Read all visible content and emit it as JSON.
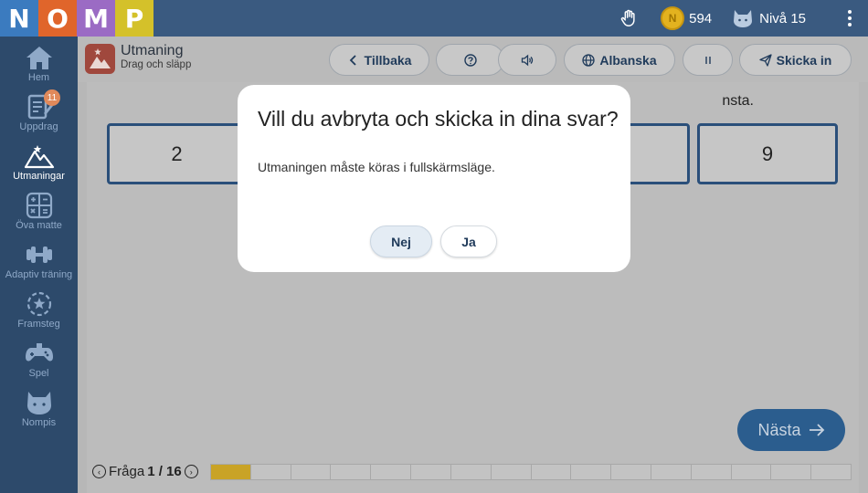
{
  "logo": {
    "letters": [
      "N",
      "O",
      "M",
      "P"
    ],
    "colors": [
      "#3b7bbf",
      "#e0652b",
      "#9b6bc4",
      "#d4c12a"
    ]
  },
  "topbar": {
    "coins": "594",
    "level": "Nivå 15"
  },
  "sidebar": {
    "items": [
      {
        "label": "Hem",
        "icon": "home-icon"
      },
      {
        "label": "Uppdrag",
        "icon": "assignment-icon",
        "badge": "11"
      },
      {
        "label": "Utmaningar",
        "icon": "mountain-icon"
      },
      {
        "label": "Öva matte",
        "icon": "calculator-icon"
      },
      {
        "label": "Adaptiv träning",
        "icon": "dumbbell-icon"
      },
      {
        "label": "Framsteg",
        "icon": "star-progress-icon"
      },
      {
        "label": "Spel",
        "icon": "gamepad-icon"
      },
      {
        "label": "Nompis",
        "icon": "cat-icon"
      }
    ]
  },
  "header": {
    "title": "Utmaning",
    "subtitle": "Drag och släpp",
    "back_label": "Tillbaka",
    "language_label": "Albanska",
    "submit_label": "Skicka in"
  },
  "exercise": {
    "instruction_visible": "nsta.",
    "boxes": [
      "2",
      "9"
    ]
  },
  "next_label": "Nästa",
  "progress": {
    "prefix": "Fråga",
    "value": "1 / 16",
    "done": 1,
    "total": 16
  },
  "modal": {
    "title": "Vill du avbryta och skicka in dina svar?",
    "text": "Utmaningen måste köras i fullskärmsläge.",
    "no_label": "Nej",
    "yes_label": "Ja"
  }
}
